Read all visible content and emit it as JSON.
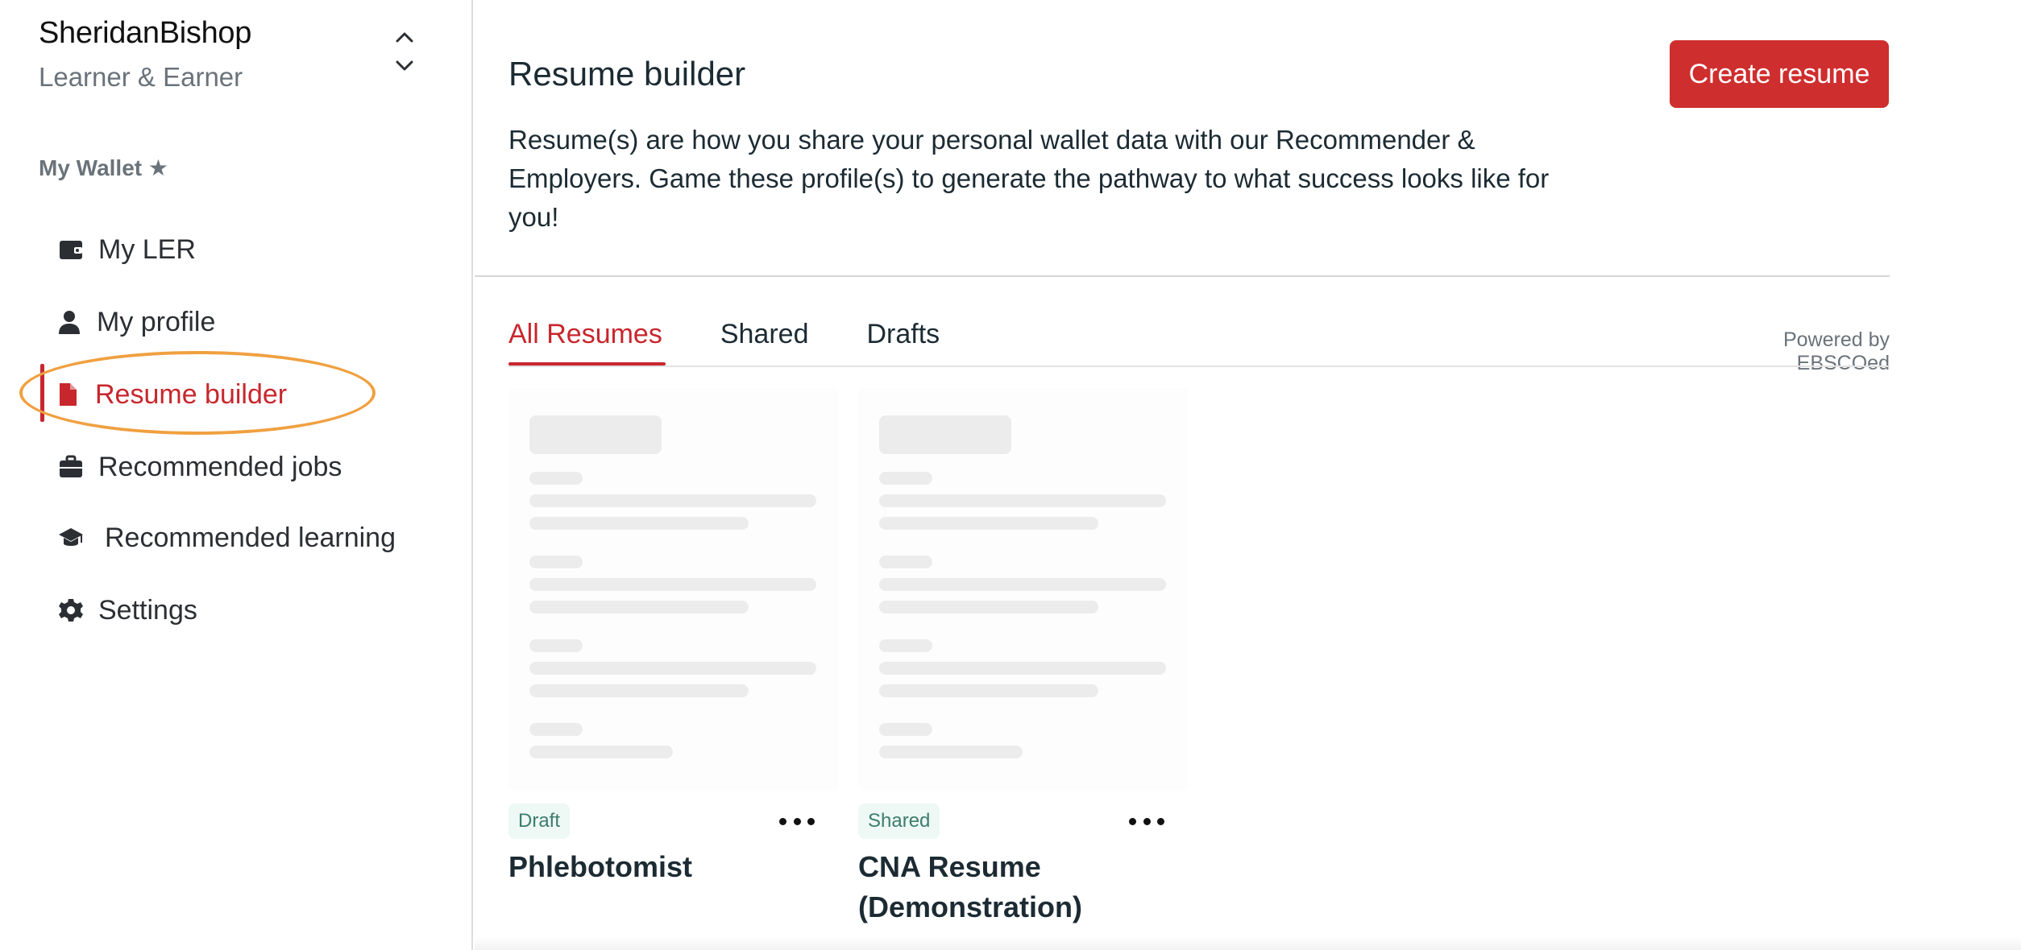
{
  "user": {
    "name": "SheridanBishop",
    "role": "Learner & Earner"
  },
  "sidebar": {
    "section_label": "My Wallet ★",
    "items": [
      {
        "label": "My LER",
        "icon": "wallet-icon"
      },
      {
        "label": "My profile",
        "icon": "user-icon"
      },
      {
        "label": "Resume builder",
        "icon": "file-icon",
        "active": true
      },
      {
        "label": "Recommended jobs",
        "icon": "briefcase-icon"
      },
      {
        "label": "Recommended learning",
        "icon": "graduation-cap-icon"
      },
      {
        "label": "Settings",
        "icon": "gear-icon"
      }
    ]
  },
  "header": {
    "title": "Resume builder",
    "create_button": "Create resume",
    "description": "Resume(s) are how you share your personal wallet data with our Recommender & Employers. Game these profile(s) to generate the pathway to what success looks like for you!"
  },
  "tabs": [
    {
      "label": "All Resumes",
      "active": true
    },
    {
      "label": "Shared",
      "active": false
    },
    {
      "label": "Drafts",
      "active": false
    }
  ],
  "powered_by": "Powered by EBSCOed",
  "resumes": [
    {
      "status": "Draft",
      "title": "Phlebotomist"
    },
    {
      "status": "Shared",
      "title": "CNA Resume (Demonstration)"
    }
  ],
  "colors": {
    "accent": "#c8262d",
    "button": "#cf2e2e",
    "highlight": "#f0a040",
    "badge_text": "#3c7d6c",
    "badge_bg": "#eef8f5"
  }
}
